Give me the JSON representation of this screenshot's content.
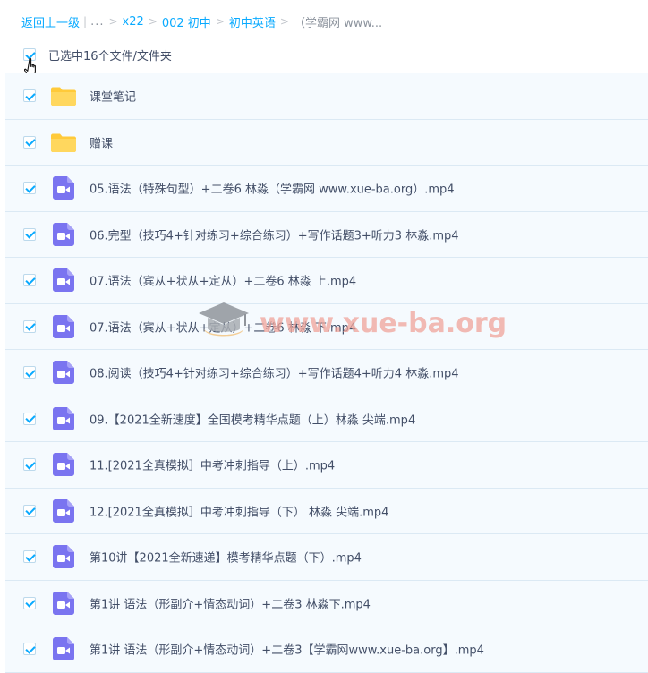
{
  "breadcrumb": {
    "back": "返回上一级",
    "sep_bar": "|",
    "ellipsis": "...",
    "sep": ">",
    "items": [
      "x22",
      "002 初中",
      "初中英语"
    ],
    "current": "（学霸网 www..."
  },
  "selection": {
    "label": "已选中16个文件/文件夹",
    "checked": true
  },
  "files": [
    {
      "type": "folder",
      "name": "课堂笔记",
      "checked": true
    },
    {
      "type": "folder",
      "name": "赠课",
      "checked": true
    },
    {
      "type": "video",
      "name": "05.语法（特殊句型）+二卷6 林淼（学霸网 www.xue-ba.org）.mp4",
      "checked": true
    },
    {
      "type": "video",
      "name": "06.完型（技巧4+针对练习+综合练习）+写作话题3+听力3 林淼.mp4",
      "checked": true
    },
    {
      "type": "video",
      "name": "07.语法（宾从+状从+定从）+二卷6 林淼 上.mp4",
      "checked": true
    },
    {
      "type": "video",
      "name": "07.语法（宾从+状从+定从）+二卷6 林淼 下.mp4",
      "checked": true
    },
    {
      "type": "video",
      "name": "08.阅读（技巧4+针对练习+综合练习）+写作话题4+听力4 林淼.mp4",
      "checked": true
    },
    {
      "type": "video",
      "name": "09.【2021全新速度】全国模考精华点题（上）林淼 尖端.mp4",
      "checked": true
    },
    {
      "type": "video",
      "name": "11.[2021全真模拟］中考冲刺指导（上）.mp4",
      "checked": true
    },
    {
      "type": "video",
      "name": "12.[2021全真模拟］中考冲刺指导（下） 林淼 尖端.mp4",
      "checked": true
    },
    {
      "type": "video",
      "name": "第10讲【2021全新速递】模考精华点题（下）.mp4",
      "checked": true
    },
    {
      "type": "video",
      "name": "第1讲 语法（形副介+情态动词）+二卷3 林淼下.mp4",
      "checked": true
    },
    {
      "type": "video",
      "name": "第1讲 语法（形副介+情态动词）+二卷3【学霸网www.xue-ba.org】.mp4",
      "checked": true
    }
  ],
  "watermark": {
    "text": "www.xue-ba.org"
  },
  "icons": {
    "folder": "folder-icon",
    "video": "video-file-icon",
    "cursor": "hand-pointer-icon",
    "checkbox": "checkbox-checked-icon"
  },
  "colors": {
    "link": "#09aaff",
    "text": "#424e67",
    "muted": "#8c939d",
    "row_bg": "#f5fafe",
    "row_border": "#dbe9f4",
    "folder": "#ffca3a",
    "video": "#7a74f0",
    "check": "#09aaff"
  }
}
